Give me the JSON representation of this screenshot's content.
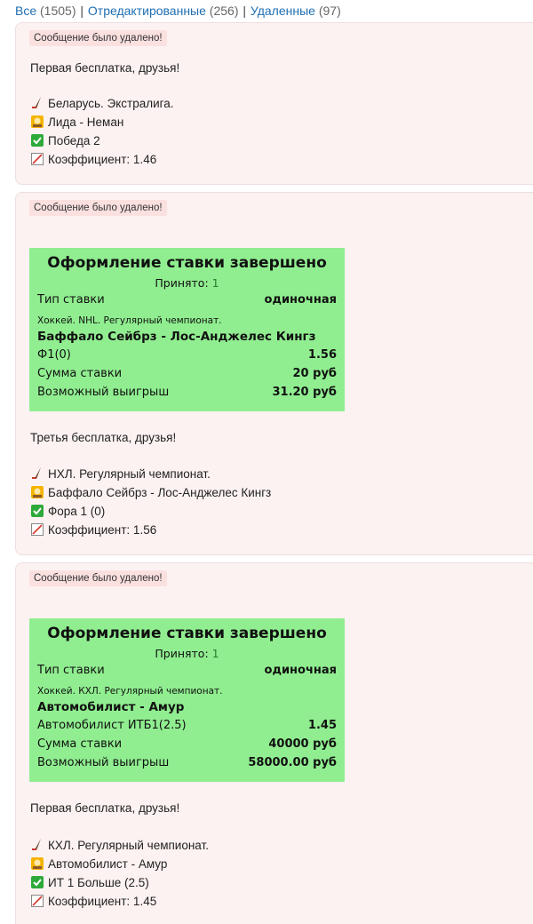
{
  "filters": [
    {
      "label": "Все",
      "count": "(1505)"
    },
    {
      "label": "Отредактированные",
      "count": "(256)"
    },
    {
      "label": "Удаленные",
      "count": "(97)"
    }
  ],
  "separator": "|",
  "icons": {
    "league": "hockey-stick-icon",
    "match": "trophy-icon",
    "pick": "checkmark-icon",
    "odds": "chart-icon"
  },
  "colors": {
    "post_bg": "#fdf2f2",
    "badge_bg": "#fbe0e0",
    "bet_bg": "#90ee90",
    "link": "#1f6fb2"
  },
  "posts": [
    {
      "badge": "Сообщение было удалено!",
      "text": "Первая бесплатка, друзья!",
      "league": "Беларусь. Экстралига.",
      "match": "Лида - Неман",
      "pick": "Победа 2",
      "odds": "Коэффициент: 1.46"
    },
    {
      "badge": "Сообщение было удалено!",
      "bet": {
        "title": "Оформление ставки завершено",
        "accepted_label": "Принято:",
        "accepted_value": "1",
        "type_label": "Тип ставки",
        "type_value": "одиночная",
        "league": "Хоккей. NHL. Регулярный чемпионат.",
        "match": "Баффало Сейбрз - Лос-Анджелес Кингз",
        "outcome_label": "Ф1(0)",
        "outcome_value": "1.56",
        "stake_label": "Сумма ставки",
        "stake_value": "20 руб",
        "win_label": "Возможный выигрыш",
        "win_value": "31.20 руб"
      },
      "text": "Третья бесплатка, друзья!",
      "league": "НХЛ. Регулярный чемпионат.",
      "match": "Баффало Сейбрз - Лос-Анджелес Кингз",
      "pick": "Фора 1 (0)",
      "odds": "Коэффициент: 1.56"
    },
    {
      "badge": "Сообщение было удалено!",
      "bet": {
        "title": "Оформление ставки завершено",
        "accepted_label": "Принято:",
        "accepted_value": "1",
        "type_label": "Тип ставки",
        "type_value": "одиночная",
        "league": "Хоккей. КХЛ. Регулярный чемпионат.",
        "match": "Автомобилист - Амур",
        "outcome_label": "Автомобилист ИТБ1(2.5)",
        "outcome_value": "1.45",
        "stake_label": "Сумма ставки",
        "stake_value": "40000 руб",
        "win_label": "Возможный выигрыш",
        "win_value": "58000.00 руб"
      },
      "text": "Первая бесплатка, друзья!",
      "league": "КХЛ. Регулярный чемпионат.",
      "match": "Автомобилист - Амур",
      "pick": "ИТ 1 Больше (2.5)",
      "odds": "Коэффициент: 1.45"
    }
  ]
}
